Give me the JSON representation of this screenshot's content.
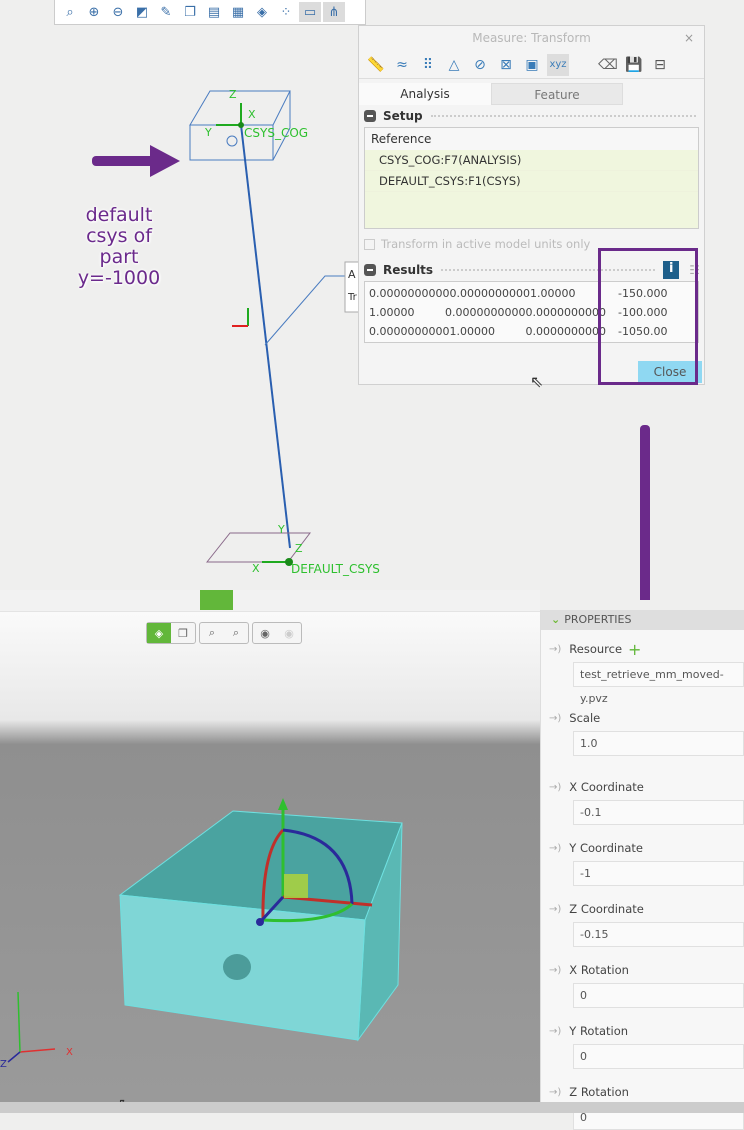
{
  "cad_toolbar": {
    "icons": [
      "zoom-fit-icon",
      "zoom-in-icon",
      "zoom-out-icon",
      "refit-icon",
      "repaint-icon",
      "display-style-icon",
      "saved-orientations-icon",
      "view-manager-icon",
      "perspective-icon",
      "datum-display-icon",
      "annotation-icon",
      "csys-display-icon"
    ]
  },
  "cad_labels": {
    "cog_csys": "CSYS_COG",
    "cog_z": "Z",
    "cog_x": "X",
    "cog_y": "Y",
    "default_csys": "DEFAULT_CSYS",
    "def_x": "X",
    "def_y": "Y",
    "def_z": "Z",
    "callout_a": "A",
    "callout_t": "Tr"
  },
  "annotation": {
    "lines": [
      "default",
      "csys of",
      "part",
      "y=-1000"
    ],
    "color": "#6b2a8c"
  },
  "dialog": {
    "title": "Measure: Transform",
    "close_x": "×",
    "tabs": [
      "Analysis",
      "Feature"
    ],
    "setup": {
      "label": "Setup",
      "reference_header": "Reference",
      "references": [
        "CSYS_COG:F7(ANALYSIS)",
        "DEFAULT_CSYS:F1(CSYS)"
      ]
    },
    "checkbox_label": "Transform in active model units only",
    "results": {
      "label": "Results",
      "rows": [
        [
          "0.0000000000",
          "0.0000000000",
          "1.00000",
          "-150.000"
        ],
        [
          "1.00000",
          "0.0000000000",
          "0.0000000000",
          "-100.000"
        ],
        [
          "0.0000000000",
          "1.00000",
          "0.0000000000",
          "-1050.00"
        ]
      ]
    },
    "close_label": "Close"
  },
  "properties": {
    "header": "PROPERTIES",
    "items": [
      {
        "label": "Resource",
        "value": "test_retrieve_mm_moved-y.pvz"
      },
      {
        "label": "Scale",
        "value": "1.0"
      },
      {
        "label": "X Coordinate",
        "value": "-0.1"
      },
      {
        "label": "Y Coordinate",
        "value": "-1"
      },
      {
        "label": "Z Coordinate",
        "value": "-0.15"
      },
      {
        "label": "X Rotation",
        "value": "0"
      },
      {
        "label": "Y Rotation",
        "value": "0"
      },
      {
        "label": "Z Rotation",
        "value": "0"
      }
    ]
  },
  "viewport_axes": {
    "x": "X",
    "z": "Z"
  },
  "colors": {
    "accent_green": "#62b73a",
    "highlight_purple": "#6a2a8a",
    "model_cyan": "#7fd6d6"
  }
}
